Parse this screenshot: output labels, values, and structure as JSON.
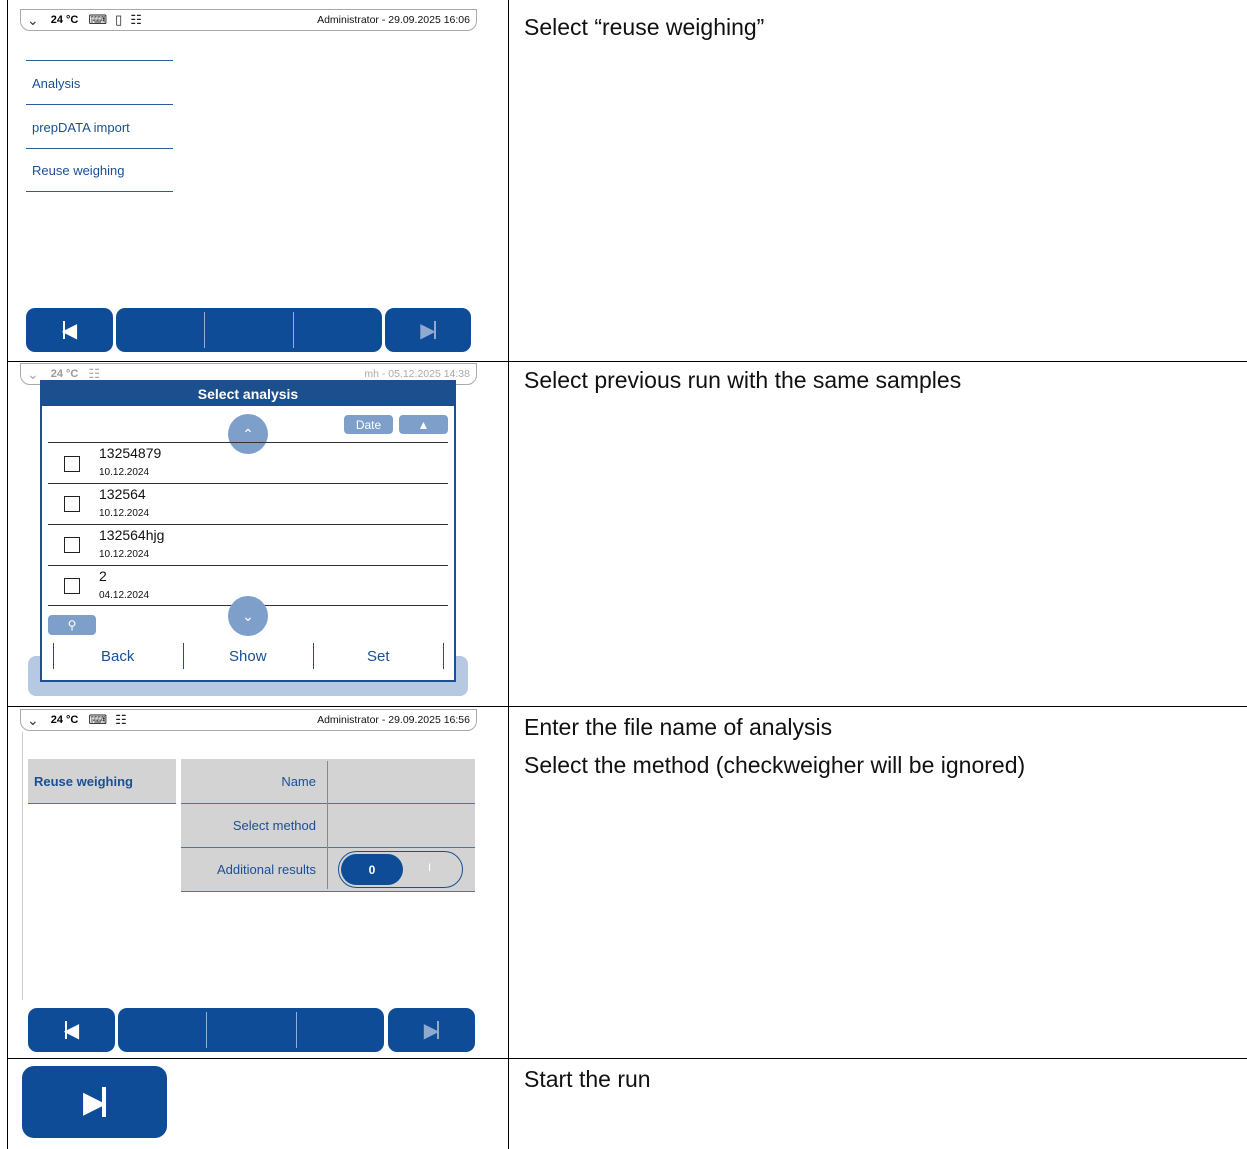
{
  "steps": [
    {
      "instruction": "Select “reuse weighing”"
    },
    {
      "instruction": "Select previous run with the same samples"
    },
    {
      "instruction_lines": [
        "Enter the file name of analysis",
        "Select the method (checkweigher will be ignored)"
      ]
    },
    {
      "instruction": "Start the run"
    }
  ],
  "screen1": {
    "status": {
      "temperature": "24 °C",
      "user_time": "Administrator - 29.09.2025 16:06"
    },
    "menu": [
      "Analysis",
      "prepDATA import",
      "Reuse weighing"
    ]
  },
  "screen2": {
    "status": {
      "temperature": "24 °C",
      "user_time": "mh - 05.12.2025 14:38"
    },
    "dialog": {
      "title": "Select analysis",
      "sort_label": "Date",
      "rows": [
        {
          "name": "13254879",
          "date": "10.12.2024"
        },
        {
          "name": "132564",
          "date": "10.12.2024"
        },
        {
          "name": "132564hjg",
          "date": "10.12.2024"
        },
        {
          "name": "2",
          "date": "04.12.2024"
        }
      ],
      "actions": {
        "back": "Back",
        "show": "Show",
        "set": "Set"
      }
    }
  },
  "screen3": {
    "status": {
      "temperature": "24 °C",
      "user_time": "Administrator - 29.09.2025 16:56"
    },
    "section": "Reuse weighing",
    "fields": {
      "name": "Name",
      "method": "Select method",
      "additional": "Additional results"
    },
    "toggle_value": "0",
    "toggle_alt": "I"
  },
  "icons": {
    "first": "skip-to-start-icon",
    "last": "skip-to-end-icon",
    "chevron": "chevron-down-icon",
    "scroll_up": "chevron-up-icon",
    "scroll_down": "chevron-down-icon",
    "search": "search-icon",
    "sort": "triangle-up-icon"
  },
  "colors": {
    "primary": "#0f4c97",
    "disabled": "#7f9fcb",
    "field_bg": "#d3d3d3"
  }
}
